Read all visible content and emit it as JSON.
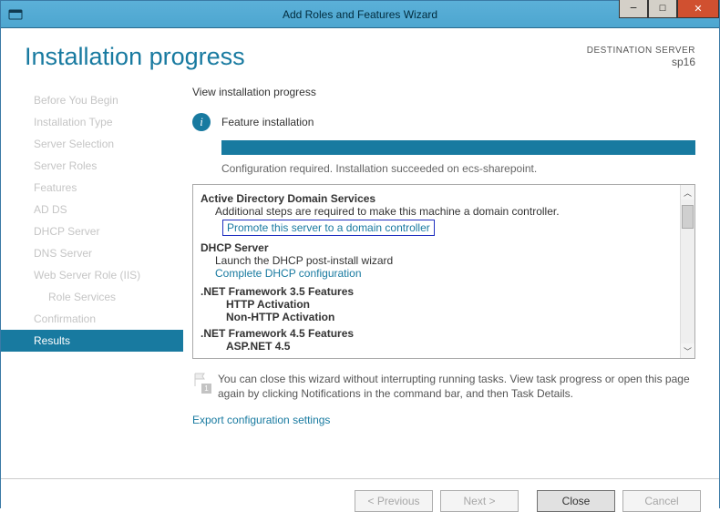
{
  "window": {
    "title": "Add Roles and Features Wizard"
  },
  "header": {
    "title": "Installation progress",
    "destination_label": "DESTINATION SERVER",
    "server_name": "sp16"
  },
  "sidebar": {
    "items": [
      {
        "label": "Before You Begin"
      },
      {
        "label": "Installation Type"
      },
      {
        "label": "Server Selection"
      },
      {
        "label": "Server Roles"
      },
      {
        "label": "Features"
      },
      {
        "label": "AD DS"
      },
      {
        "label": "DHCP Server"
      },
      {
        "label": "DNS Server"
      },
      {
        "label": "Web Server Role (IIS)"
      },
      {
        "label": "Role Services"
      },
      {
        "label": "Confirmation"
      },
      {
        "label": "Results"
      }
    ]
  },
  "main": {
    "view_label": "View installation progress",
    "status_title": "Feature installation",
    "status_message": "Configuration required. Installation succeeded on ecs-sharepoint.",
    "results": {
      "adds": {
        "title": "Active Directory Domain Services",
        "note": "Additional steps are required to make this machine a domain controller.",
        "link": "Promote this server to a domain controller"
      },
      "dhcp": {
        "title": "DHCP Server",
        "note": "Launch the DHCP post-install wizard",
        "link": "Complete DHCP configuration"
      },
      "net35": {
        "title": ".NET Framework 3.5 Features",
        "items": [
          "HTTP Activation",
          "Non-HTTP Activation"
        ]
      },
      "net45": {
        "title": ".NET Framework 4.5 Features",
        "items": [
          "ASP.NET 4.5"
        ]
      }
    },
    "footer_note": "You can close this wizard without interrupting running tasks. View task progress or open this page again by clicking Notifications in the command bar, and then Task Details.",
    "footer_badge": "1",
    "export_link": "Export configuration settings"
  },
  "buttons": {
    "previous": "< Previous",
    "next": "Next >",
    "close": "Close",
    "cancel": "Cancel"
  }
}
